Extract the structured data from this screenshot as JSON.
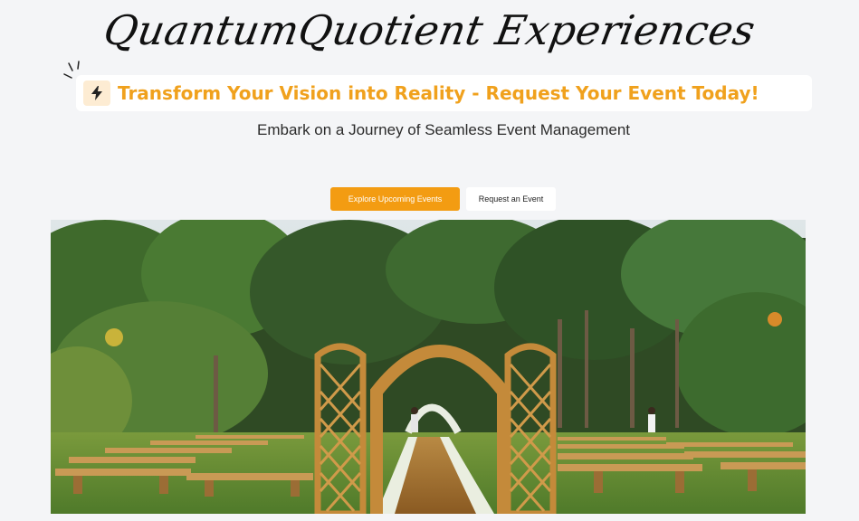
{
  "brand": {
    "title": "QuantumQuotient Experiences"
  },
  "banner": {
    "icon": "lightning-bolt-icon",
    "text": "Transform Your Vision into Reality - Request Your Event Today!",
    "accent_color": "#f0a11d"
  },
  "hero": {
    "subtitle": "Embark on a Journey of Seamless Event Management"
  },
  "actions": {
    "primary_label": "Explore  Upcoming Events",
    "primary_color": "#f39c12",
    "secondary_label": "Request an Event"
  },
  "image": {
    "alt": "Outdoor wedding ceremony with wooden arch, lattice gates and benches in a tropical garden"
  }
}
